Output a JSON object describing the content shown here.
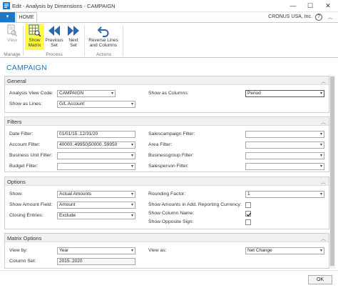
{
  "window": {
    "title": "Edit - Analysis by Dimensions - CAMPAIGN",
    "minimize": "—",
    "maximize": "☐",
    "close": "✕"
  },
  "tabs": {
    "menu": "▾",
    "home": "HOME",
    "company": "CRONUS USA, Inc.",
    "help": "?",
    "collapse": "︿"
  },
  "ribbon": {
    "view_label": "View",
    "show_matrix_line1": "Show",
    "show_matrix_line2": "Matrix",
    "previous_set_line1": "Previous",
    "previous_set_line2": "Set",
    "next_set_line1": "Next",
    "next_set_line2": "Set",
    "reverse_line1": "Reverse Lines",
    "reverse_line2": "and Columns",
    "group_manage": "Manage",
    "group_process": "Process",
    "group_actions": "Actions",
    "highlight_color": "#fff94a",
    "accent_color": "#1978c8"
  },
  "page": {
    "title": "CAMPAIGN"
  },
  "general": {
    "header": "General",
    "analysis_view_code_label": "Analysis View Code:",
    "analysis_view_code_value": "CAMPAIGN",
    "show_as_lines_label": "Show as Lines:",
    "show_as_lines_value": "G/L Account",
    "show_as_columns_label": "Show as Columns:",
    "show_as_columns_value": "Period"
  },
  "filters": {
    "header": "Filters",
    "date_filter_label": "Date Filter:",
    "date_filter_value": "01/01/15..12/31/20",
    "account_filter_label": "Account Filter:",
    "account_filter_value": "40000..49950|50000..59950",
    "business_unit_filter_label": "Business Unit Filter:",
    "business_unit_filter_value": "",
    "budget_filter_label": "Budget Filter:",
    "budget_filter_value": "",
    "salescampaign_filter_label": "Salescampaign Filter:",
    "salescampaign_filter_value": "",
    "area_filter_label": "Area Filter:",
    "area_filter_value": "",
    "businessgroup_filter_label": "Businessgroup Filter:",
    "businessgroup_filter_value": "",
    "salesperson_filter_label": "Salesperson Filter:",
    "salesperson_filter_value": ""
  },
  "options": {
    "header": "Options",
    "show_label": "Show:",
    "show_value": "Actual Amounts",
    "show_amount_field_label": "Show Amount Field:",
    "show_amount_field_value": "Amount",
    "closing_entries_label": "Closing Entries:",
    "closing_entries_value": "Exclude",
    "rounding_factor_label": "Rounding Factor:",
    "rounding_factor_value": "1",
    "show_amounts_add_currency_label": "Show Amounts in Add. Reporting Currency:",
    "show_column_name_label": "Show Column Name:",
    "show_opposite_sign_label": "Show Opposite Sign:",
    "show_amounts_add_currency_checked": false,
    "show_column_name_checked": true,
    "show_opposite_sign_checked": false
  },
  "matrix_options": {
    "header": "Matrix Options",
    "view_by_label": "View by:",
    "view_by_value": "Year",
    "column_set_label": "Column Set:",
    "column_set_value": "2015..2020",
    "view_as_label": "View as:",
    "view_as_value": "Net Change"
  },
  "footer": {
    "ok_label": "OK"
  },
  "icons": {
    "dropdown": "▾",
    "collapse_chevron": "︿"
  }
}
